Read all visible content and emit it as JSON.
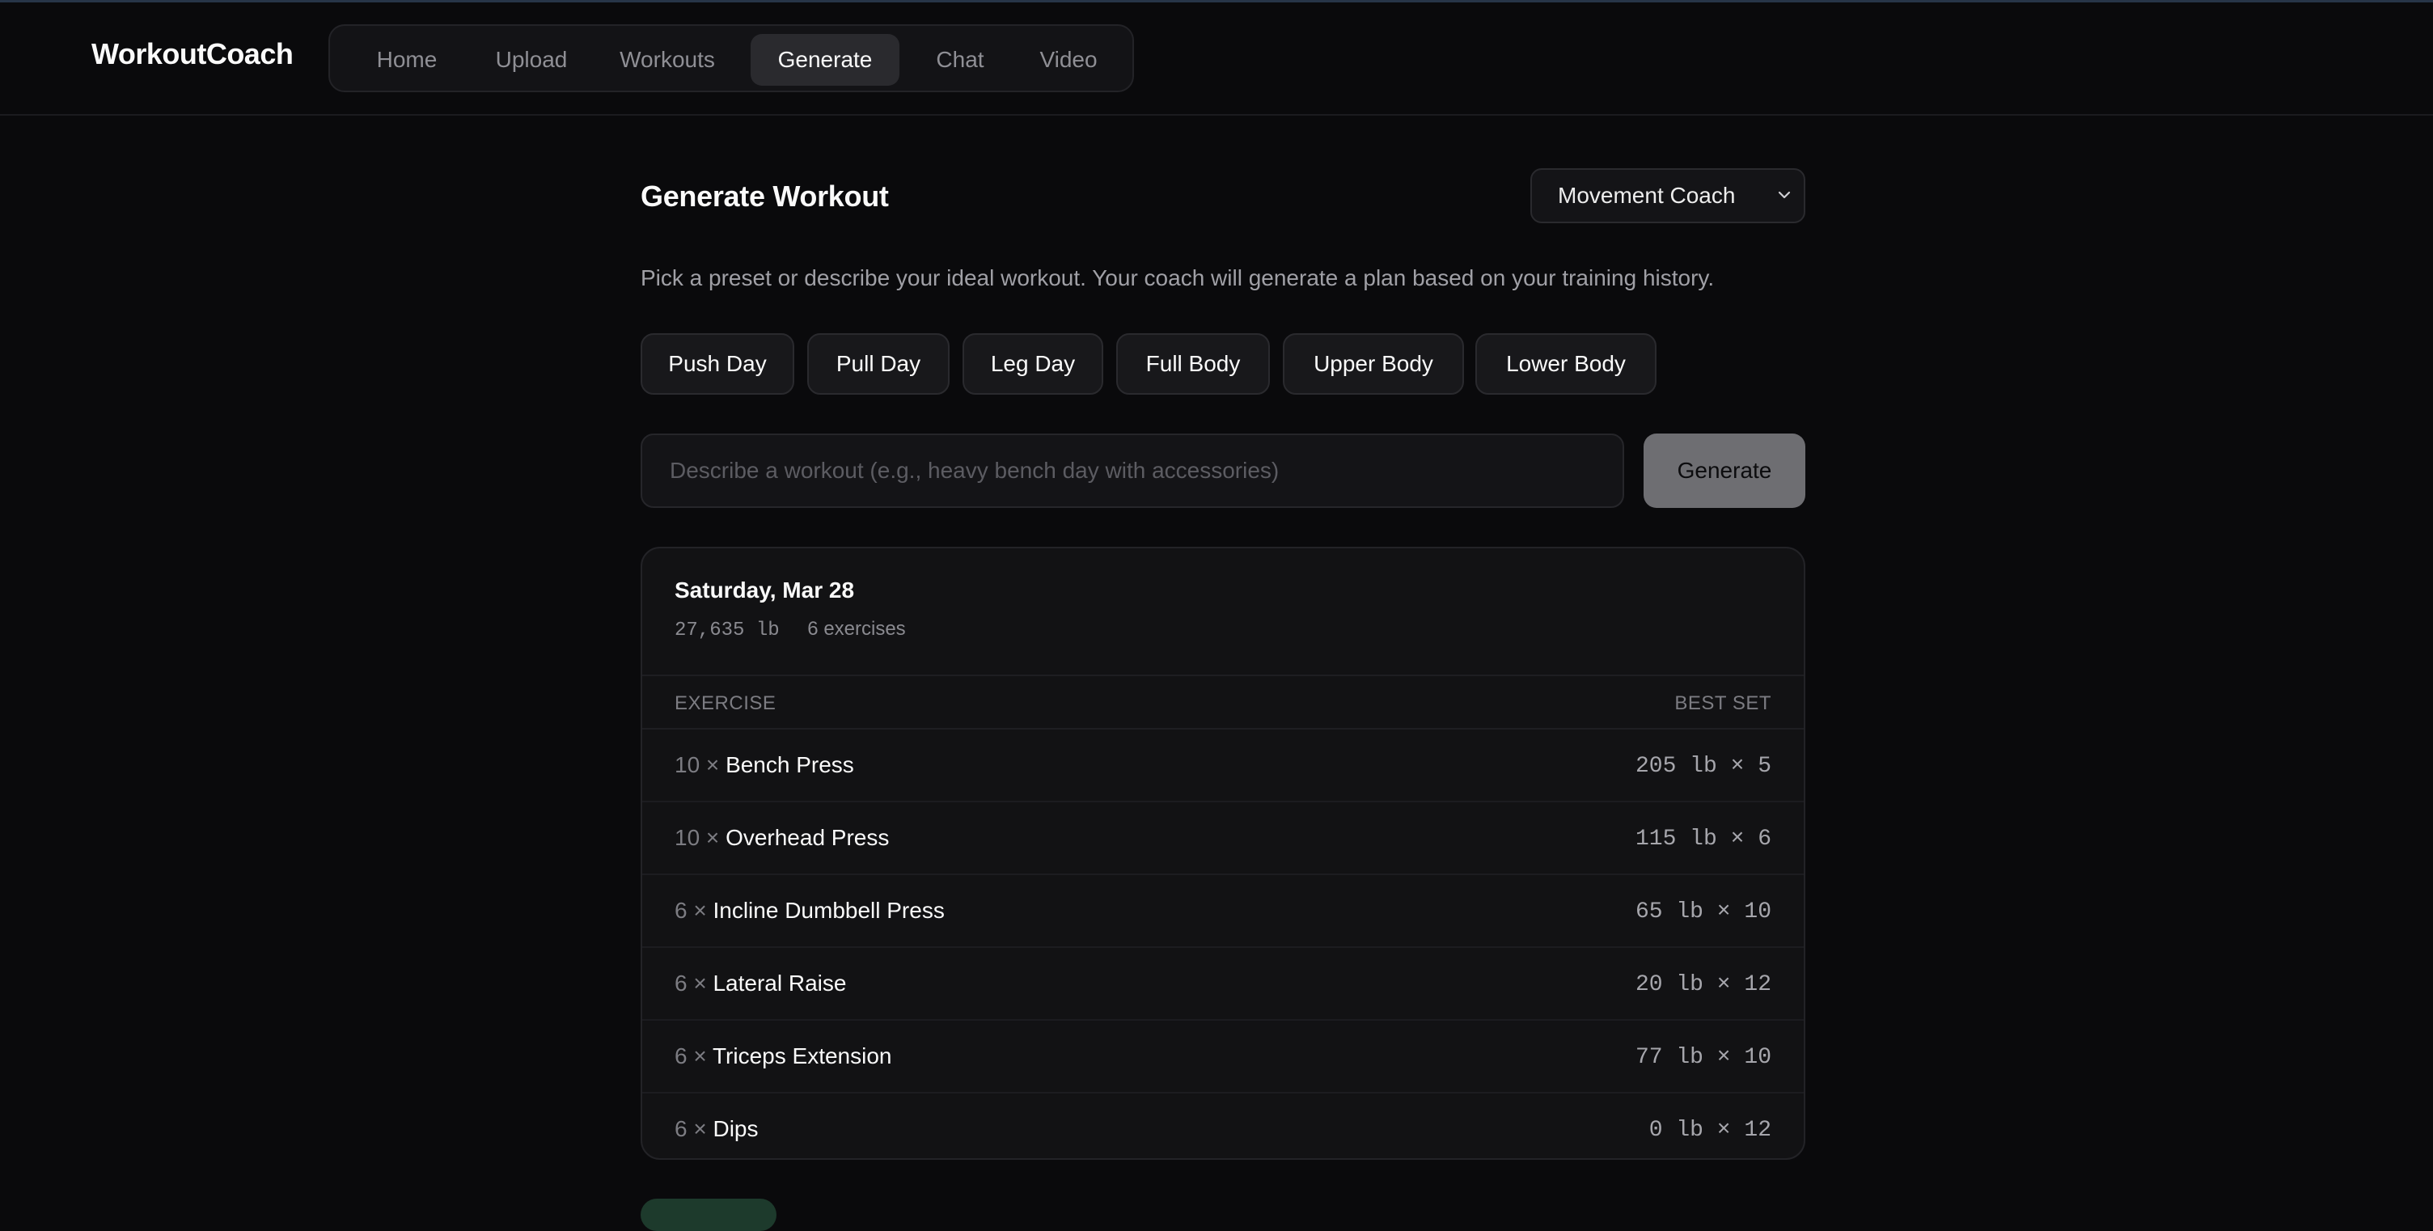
{
  "app": {
    "brand": "WorkoutCoach"
  },
  "nav": {
    "items": [
      {
        "label": "Home",
        "active": false
      },
      {
        "label": "Upload",
        "active": false
      },
      {
        "label": "Workouts",
        "active": false
      },
      {
        "label": "Generate",
        "active": true
      },
      {
        "label": "Chat",
        "active": false
      },
      {
        "label": "Video",
        "active": false
      }
    ]
  },
  "page": {
    "title": "Generate Workout",
    "coach_select": {
      "value": "Movement Coach"
    },
    "subtitle": "Pick a preset or describe your ideal workout. Your coach will generate a plan based on your training history."
  },
  "presets": [
    "Push Day",
    "Pull Day",
    "Leg Day",
    "Full Body",
    "Upper Body",
    "Lower Body"
  ],
  "prompt": {
    "placeholder": "Describe a workout (e.g., heavy bench day with accessories)",
    "value": ""
  },
  "generate_button": {
    "label": "Generate"
  },
  "workout": {
    "date": "Saturday, Mar 28",
    "volume": "27,635 lb",
    "exercise_count": "6 exercises",
    "columns": {
      "exercise": "EXERCISE",
      "best_set": "BEST SET"
    },
    "rows": [
      {
        "sets": "10 ×",
        "name": "Bench Press",
        "best": "205 lb × 5"
      },
      {
        "sets": "10 ×",
        "name": "Overhead Press",
        "best": "115 lb × 6"
      },
      {
        "sets": "6 ×",
        "name": "Incline Dumbbell Press",
        "best": "65 lb × 10"
      },
      {
        "sets": "6 ×",
        "name": "Lateral Raise",
        "best": "20 lb × 12"
      },
      {
        "sets": "6 ×",
        "name": "Triceps Extension",
        "best": "77 lb × 10"
      },
      {
        "sets": "6 ×",
        "name": "Dips",
        "best": "0 lb × 12"
      }
    ]
  },
  "colors": {
    "background": "#0a0a0c",
    "card": "#121214",
    "active_tab": "#2a2a2e",
    "generate_button": "#6e6e72",
    "peek_button": "#1d3a2c"
  }
}
